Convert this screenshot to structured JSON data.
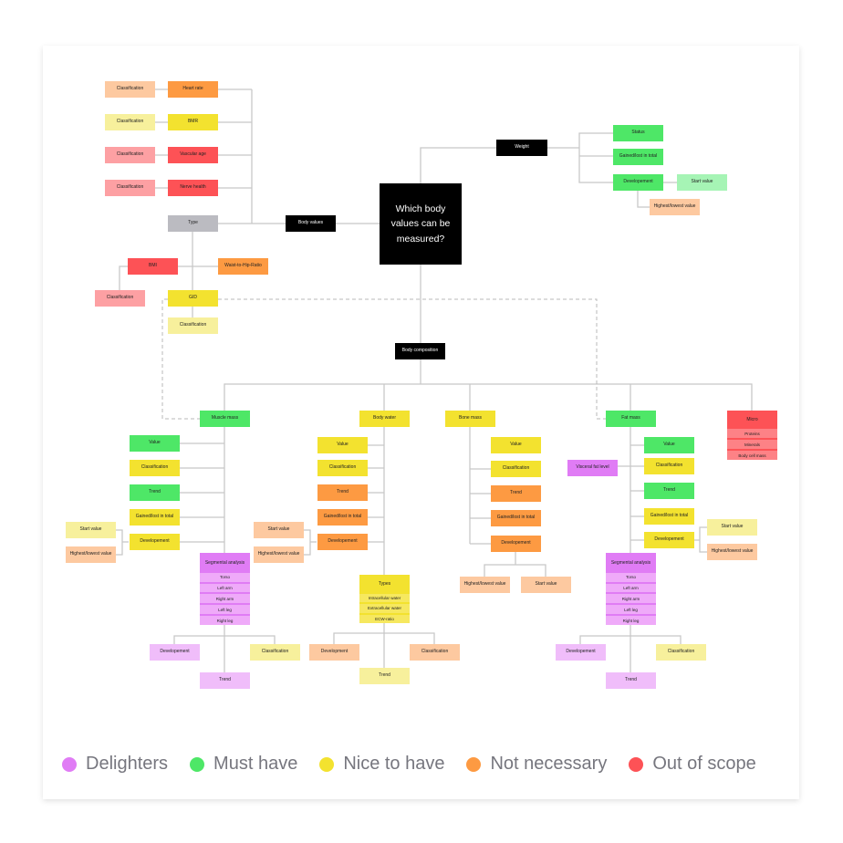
{
  "title": "Which body values can be measured?",
  "colors": {
    "delighters": "#e07cf5",
    "delighters_light": "#f0bdfa",
    "must_have": "#4ee767",
    "must_have_light": "#a6f4b5",
    "nice_to_have": "#f3e22f",
    "nice_to_have_light": "#f7f09c",
    "not_necessary": "#fd9a42",
    "not_necessary_light": "#fdc9a0",
    "out_of_scope": "#fd5256",
    "out_of_scope_light": "#fda0a3",
    "type_gray": "#bbbbc1"
  },
  "legend": [
    {
      "label": "Delighters",
      "color": "#e07cf5"
    },
    {
      "label": "Must have",
      "color": "#4ee767"
    },
    {
      "label": "Nice to have",
      "color": "#f3e22f"
    },
    {
      "label": "Not necessary",
      "color": "#fd9a42"
    },
    {
      "label": "Out of scope",
      "color": "#fd5256"
    }
  ],
  "body_values": {
    "label": "Body values",
    "heart_rate": {
      "label": "Heart rate",
      "classification": "Classification"
    },
    "bmr": {
      "label": "BMR",
      "classification": "Classification"
    },
    "vascular_age": {
      "label": "Vascular age",
      "classification": "Classification"
    },
    "nerve_health": {
      "label": "Nerve health",
      "classification": "Classification"
    },
    "type": {
      "label": "Type"
    },
    "bmi": {
      "label": "BMI",
      "classification": "Classification"
    },
    "waist_to_hip": {
      "label": "Waist-to-Hip-Ratio"
    },
    "gid": {
      "label": "GID",
      "classification": "Classification"
    }
  },
  "weight": {
    "label": "Weight",
    "status": "Status",
    "gained_lost": "Gained/lost in total",
    "development": "Developement",
    "start_value": "Start value",
    "highest_lowest": "Highest/lowest value"
  },
  "body_composition": {
    "label": "Body composition",
    "muscle_mass": {
      "label": "Muscle mass",
      "value": "Value",
      "classification": "Classification",
      "trend": "Trend",
      "gained_lost": "Gained/lost in total",
      "development": "Developement",
      "start_value": "Start value",
      "highest_lowest": "Highest/lowest value",
      "segmental": {
        "label": "Segmental analysis",
        "items": [
          "Torso",
          "Left arm",
          "Right arm",
          "Left leg",
          "Right leg"
        ]
      },
      "seg_development": "Developement",
      "seg_classification": "Classification",
      "seg_trend": "Trend"
    },
    "body_water": {
      "label": "Body water",
      "value": "Value",
      "classification": "Classification",
      "trend": "Trend",
      "gained_lost": "Gained/lost in total",
      "development": "Developement",
      "start_value": "Start value",
      "highest_lowest": "Highest/lowest value",
      "types": {
        "label": "Types",
        "items": [
          "Intracellular water",
          "Extracellular water",
          "ECW-ratio"
        ]
      },
      "types_development": "Development",
      "types_classification": "Classification",
      "types_trend": "Trend"
    },
    "bone_mass": {
      "label": "Bone mass",
      "value": "Value",
      "classification": "Classification",
      "trend": "Trend",
      "gained_lost": "Gained/lost in total",
      "development": "Developement",
      "highest_lowest": "Highest/lowest value",
      "start_value": "Start value"
    },
    "fat_mass": {
      "label": "Fat mass",
      "value": "Value",
      "visceral": "Visceral fat level",
      "classification": "Classification",
      "trend": "Trend",
      "gained_lost": "Gained/lost in total",
      "development": "Developement",
      "start_value": "Start value",
      "highest_lowest": "Highest/lowest value",
      "segmental": {
        "label": "Segmental analysis",
        "items": [
          "Torso",
          "Left arm",
          "Right arm",
          "Left leg",
          "Right leg"
        ]
      },
      "seg_development": "Developement",
      "seg_classification": "Classification",
      "seg_trend": "Trend"
    },
    "micro": {
      "label": "Micro",
      "items": [
        "Proteins",
        "Minerals",
        "Body cell mass"
      ]
    }
  }
}
